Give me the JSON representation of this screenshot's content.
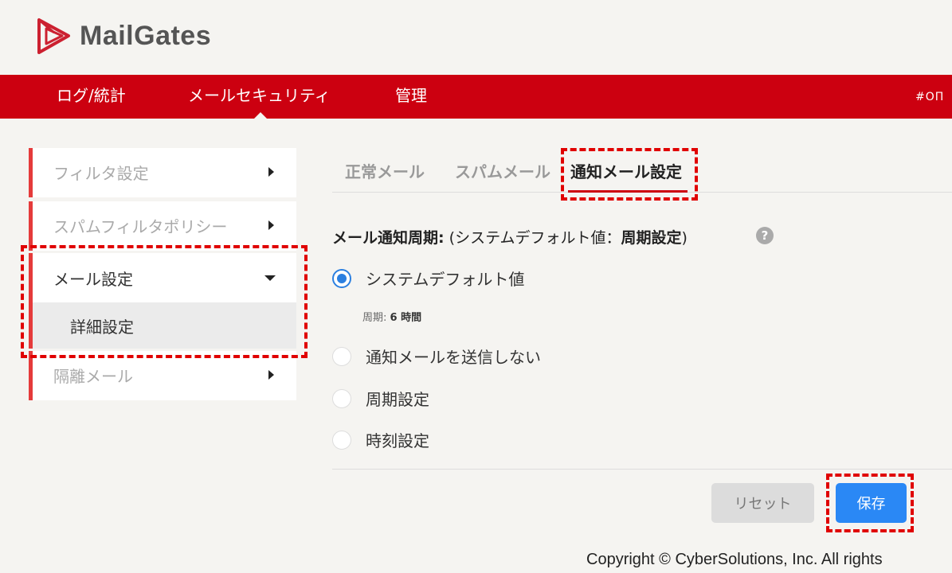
{
  "app": {
    "logo_text": "MailGates",
    "brand_color": "#cc0010"
  },
  "nav": {
    "items": [
      {
        "label": "ログ/統計"
      },
      {
        "label": "メールセキュリティ",
        "active": true
      },
      {
        "label": "管理"
      }
    ],
    "user_text": "#ОП"
  },
  "sidebar": {
    "items": [
      {
        "label": "フィルタ設定"
      },
      {
        "label": "スパムフィルタポリシー"
      },
      {
        "label": "メール設定",
        "expanded": true
      },
      {
        "label": "隔離メール"
      }
    ],
    "sub_items": [
      {
        "label": "詳細設定"
      }
    ]
  },
  "tabs": [
    {
      "label": "正常メール"
    },
    {
      "label": "スパムメール"
    },
    {
      "label": "通知メール設定",
      "active": true
    }
  ],
  "form": {
    "section_label": "メール通知周期:",
    "section_note_prefix": "(システムデフォルト値：",
    "section_note_value": "周期設定",
    "section_note_suffix": ")",
    "help_icon": "?",
    "options": [
      {
        "label": "システムデフォルト値",
        "checked": true
      },
      {
        "label": "通知メールを送信しない",
        "checked": false
      },
      {
        "label": "周期設定",
        "checked": false
      },
      {
        "label": "時刻設定",
        "checked": false
      }
    ],
    "period_label": "周期:",
    "period_value": "6 時間"
  },
  "buttons": {
    "reset": "リセット",
    "save": "保存"
  },
  "footer": {
    "copyright": "Copyright © CyberSolutions, Inc. All rights"
  },
  "colors": {
    "accent": "#cc0010",
    "primary_button": "#2a88f5",
    "highlight": "#e00000"
  }
}
